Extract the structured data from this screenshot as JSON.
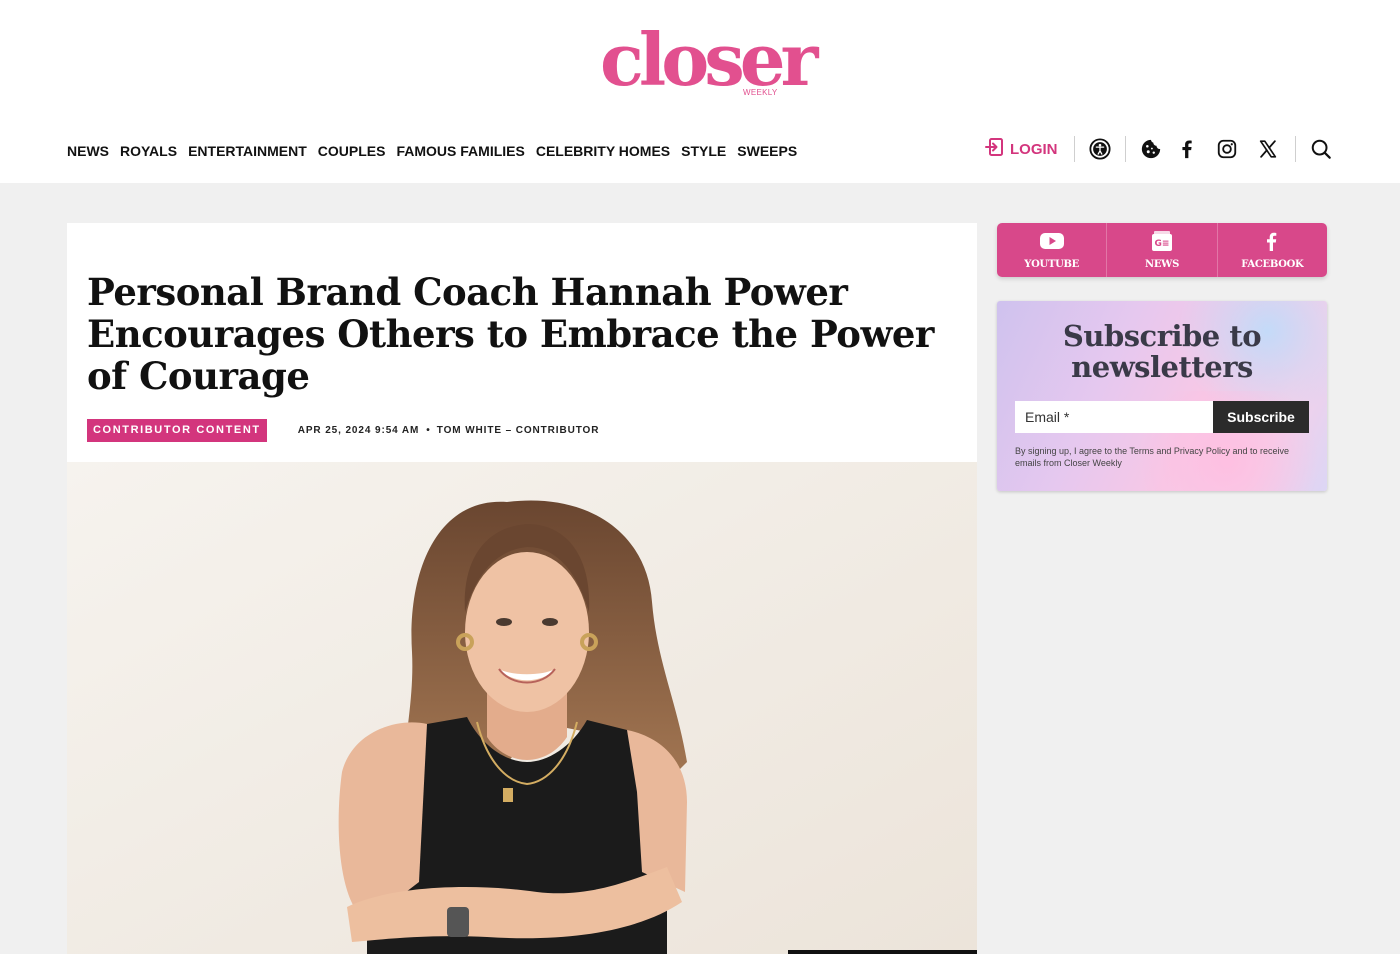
{
  "site": {
    "logo_text": "closer",
    "logo_sub": "WEEKLY",
    "brand_color": "#e2508f",
    "accent_color": "#d3357d"
  },
  "nav": {
    "items": [
      "NEWS",
      "ROYALS",
      "ENTERTAINMENT",
      "COUPLES",
      "FAMOUS FAMILIES",
      "CELEBRITY HOMES",
      "STYLE",
      "SWEEPS"
    ]
  },
  "tools": {
    "login_label": "LOGIN",
    "icons": [
      "accessibility-icon",
      "cookie-icon",
      "facebook-icon",
      "instagram-icon",
      "x-icon",
      "search-icon"
    ]
  },
  "article": {
    "title": "Personal Brand Coach Hannah Power Encourages Others to Embrace the Power of Courage",
    "category": "CONTRIBUTOR CONTENT",
    "date": "APR 25, 2024 9:54 AM",
    "separator": "•",
    "author": "TOM WHITE – CONTRIBUTOR"
  },
  "sidebar": {
    "social": [
      {
        "label": "YOUTUBE",
        "icon": "youtube-icon"
      },
      {
        "label": "NEWS",
        "icon": "google-news-icon"
      },
      {
        "label": "FACEBOOK",
        "icon": "facebook-icon"
      }
    ],
    "newsletter": {
      "title": "Subscribe to newsletters",
      "email_placeholder": "Email *",
      "button_label": "Subscribe",
      "legal": "By signing up, I agree to the Terms and Privacy Policy and to receive emails from Closer Weekly"
    }
  }
}
